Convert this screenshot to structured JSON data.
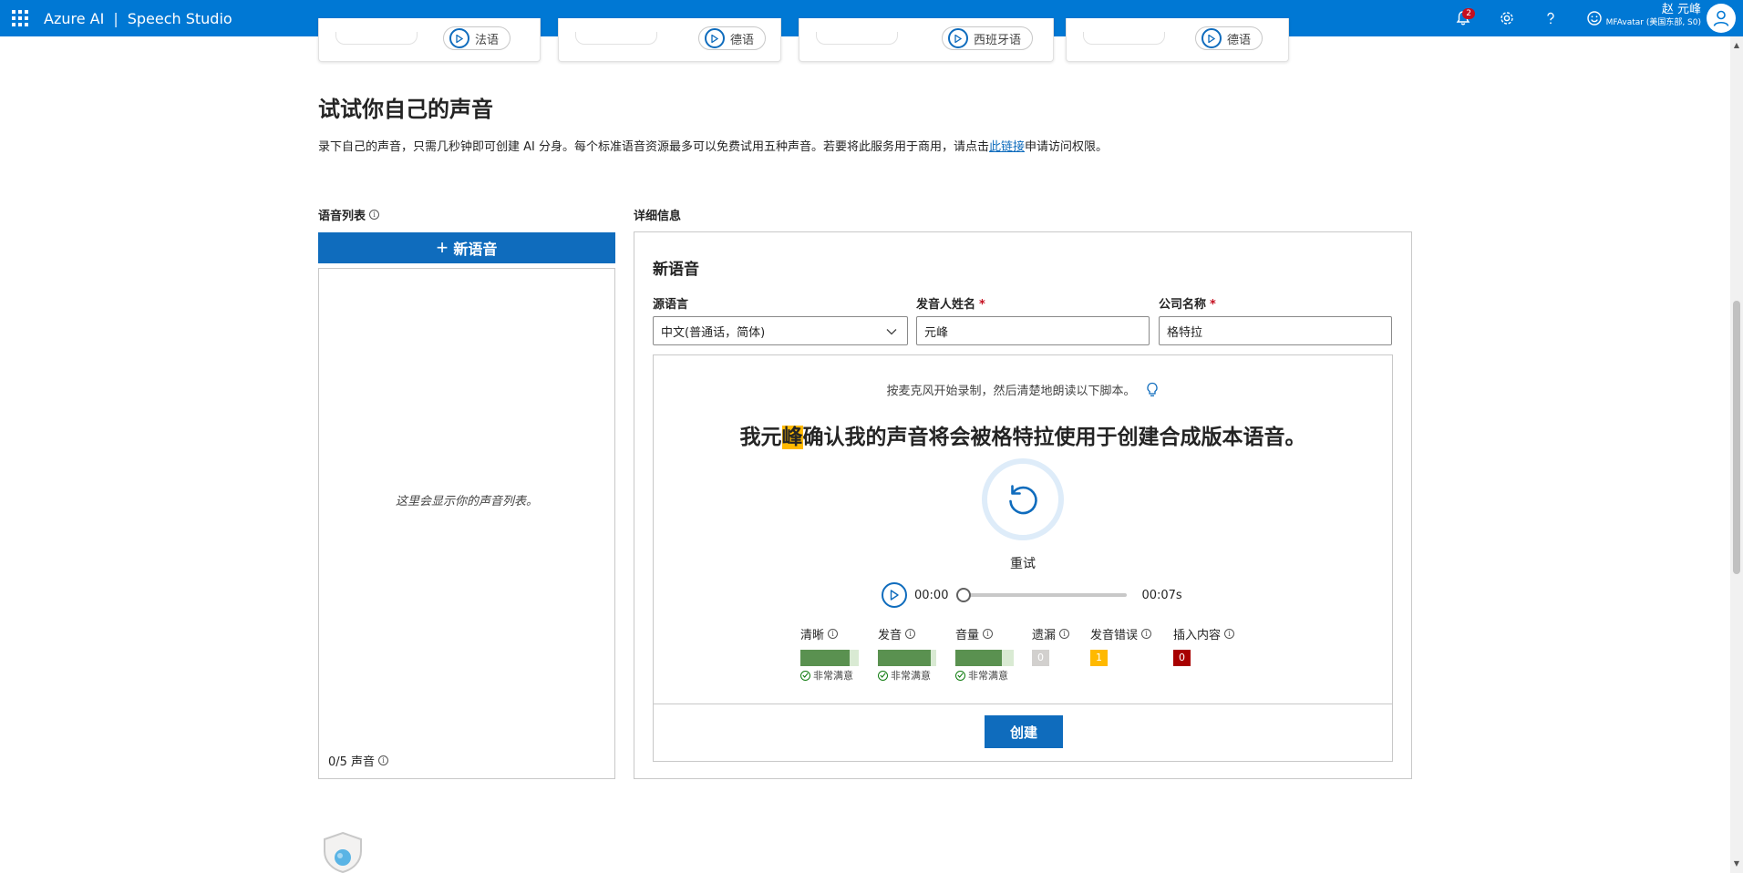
{
  "header": {
    "brand": "Azure AI",
    "separator": "|",
    "product": "Speech Studio",
    "notification_count": "2",
    "user_name": "赵 元峰",
    "user_sub": "MFAvatar (美国东部, S0)"
  },
  "top_cards": [
    {
      "pill": "法语"
    },
    {
      "pill": "德语"
    },
    {
      "pill": "西班牙语"
    },
    {
      "pill": "德语"
    }
  ],
  "section": {
    "title": "试试你自己的声音",
    "desc_before": "录下自己的声音，只需几秒钟即可创建 AI 分身。每个标准语音资源最多可以免费试用五种声音。若要将此服务用于商用，请点击",
    "desc_link": "此链接",
    "desc_after": "申请访问权限。"
  },
  "voice_list": {
    "label": "语音列表",
    "new_button": "新语音",
    "empty_text": "这里会显示你的声音列表。",
    "count": "0/5 声音"
  },
  "details": {
    "label": "详细信息",
    "title": "新语音",
    "source_language_label": "源语言",
    "source_language_value": "中文(普通话，简体)",
    "speaker_label": "发音人姓名",
    "speaker_value": "元峰",
    "company_label": "公司名称",
    "company_value": "格特拉",
    "required_mark": "*",
    "hint": "按麦克风开始录制，然后清楚地朗读以下脚本。",
    "script_before": "我元",
    "script_highlight": "峰",
    "script_after": "确认我的声音将会被格特拉使用于创建合成版本语音。",
    "retry": "重试",
    "time_current": "00:00",
    "time_total": "00:07s",
    "playback_progress": 0,
    "metrics": [
      {
        "label": "清晰",
        "level": 0.85,
        "note": "非常满意"
      },
      {
        "label": "发音",
        "level": 0.9,
        "note": "非常满意"
      },
      {
        "label": "音量",
        "level": 0.8,
        "note": "非常满意"
      }
    ],
    "counts": [
      {
        "label": "遗漏",
        "value": "0",
        "color": "#d2d0ce"
      },
      {
        "label": "发音错误",
        "value": "1",
        "color": "#ffb900"
      },
      {
        "label": "插入内容",
        "value": "0",
        "color": "#a80000"
      }
    ],
    "create_button": "创建"
  },
  "colors": {
    "accent": "#0078d4",
    "button": "#0f6cbd",
    "meter_fill": "#5a9150",
    "highlight": "#ffb900"
  }
}
